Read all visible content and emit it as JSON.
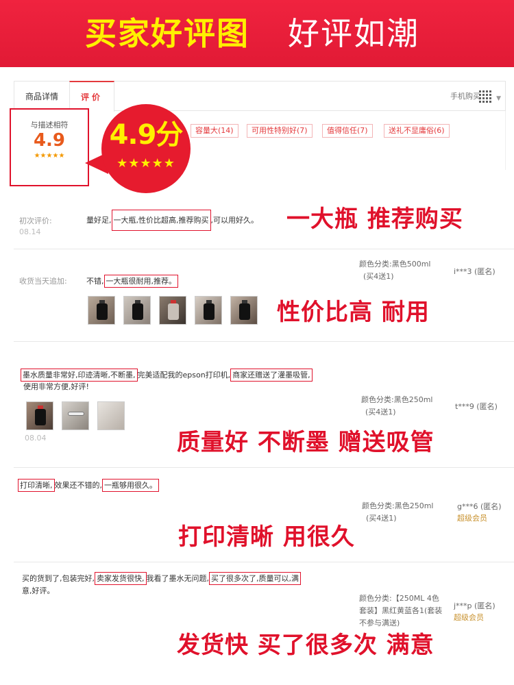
{
  "banner": {
    "title_a": "买家好评图",
    "title_b": "好评如潮"
  },
  "tabs": [
    {
      "label": "商品详情"
    },
    {
      "label": "评价"
    }
  ],
  "mobile_buy": "手机购买",
  "rating": {
    "label": "与描述相符",
    "score": "4.9",
    "stars": "★★★★★"
  },
  "tags": [
    "容量大(14)",
    "可用性特别好(7)",
    "值得信任(7)",
    "送礼不显庸俗(6)"
  ],
  "bubble": {
    "score": "4.9分",
    "stars": "★★★★★"
  },
  "reviews": [
    {
      "label": "初次评价:",
      "date": "08.14",
      "text_a": "量好足,",
      "text_hl1": "一大瓶,性价比超高,推荐购买",
      "text_b": ",可以用好久。",
      "caption": "一大瓶  推荐购买"
    },
    {
      "label": "收货当天追加:",
      "text_a": "不错,",
      "text_hl1": "一大瓶很耐用,推荐。",
      "color_label": "颜色分类:黑色500ml",
      "bundle": "(买4送1)",
      "user": "i***3 (匿名)",
      "caption": "性价比高  耐用"
    },
    {
      "text_hl1": "墨水质量非常好,印迹清晰,不断墨,",
      "text_b": "完美适配我的epson打印机,",
      "text_hl2": "商家还赠送了灌墨吸管,",
      "text_c": "使用非常方便,好评!",
      "date": "08.04",
      "color_label": "颜色分类:黑色250ml",
      "bundle": "(买4送1)",
      "user": "t***9 (匿名)",
      "caption": "质量好 不断墨  赠送吸管"
    },
    {
      "text_hl1": "打印清晰,",
      "text_b": "效果还不错的,",
      "text_hl2": "一瓶够用很久。",
      "color_label": "颜色分类:黑色250ml",
      "bundle": "(买4送1)",
      "user": "g***6 (匿名)",
      "member": "超级会员",
      "caption": "打印清晰  用很久"
    },
    {
      "text_a": "买的货到了,包装完好,",
      "text_hl1": "卖家发货很快,",
      "text_b": "我看了墨水无问题,",
      "text_hl2": "买了很多次了,质量可以,满",
      "text_c": "意,好评。",
      "color_line1": "颜色分类:【250ML 4色",
      "color_line2": "套装】黑红黄蓝各1(套装",
      "color_line3": "不参与满送)",
      "user": "j***p (匿名)",
      "member": "超级会员",
      "caption": "发货快  买了很多次  满意"
    }
  ],
  "colors": {
    "accent": "#e0112b",
    "banner": "#e11a35",
    "highlight_yellow": "#fff000",
    "score_orange": "#e85a1c",
    "member_gold": "#c8912d"
  }
}
